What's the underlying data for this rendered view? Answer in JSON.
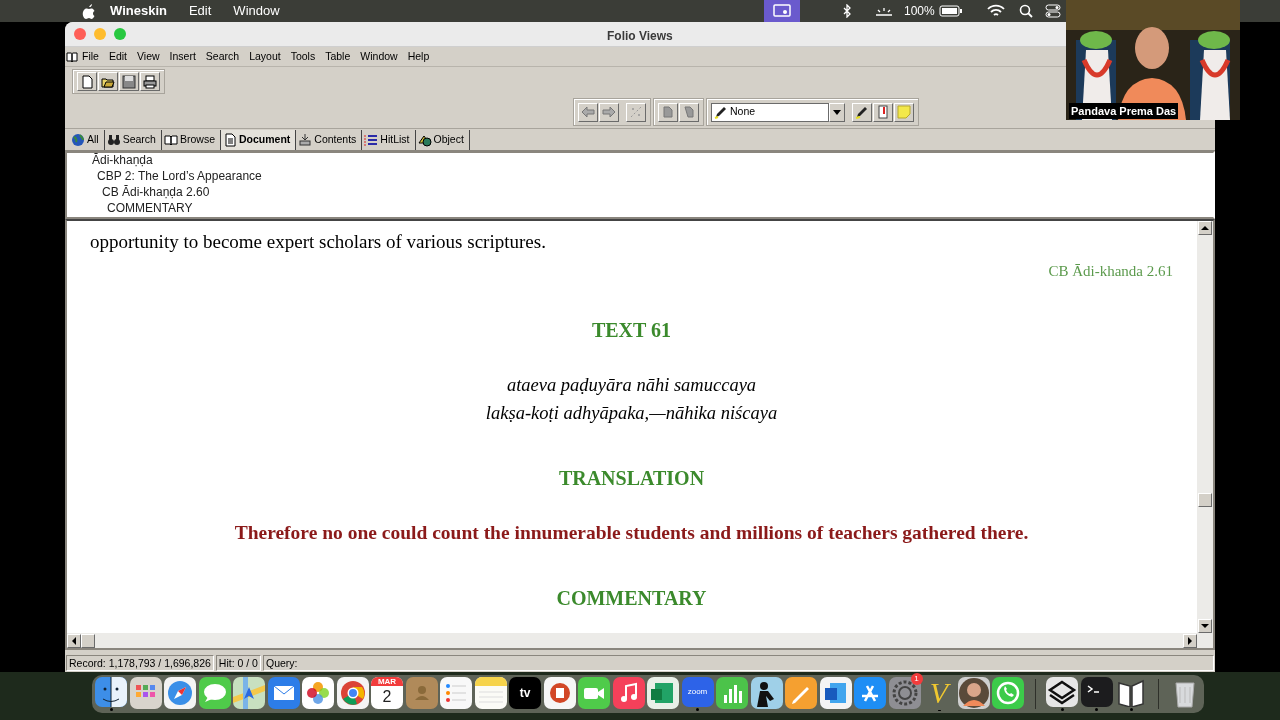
{
  "menu_bar": {
    "app": "Wineskin",
    "items": [
      "Edit",
      "Window"
    ],
    "battery": "100%"
  },
  "video": {
    "participant": "Pandava Prema Das"
  },
  "window": {
    "title": "Folio Views"
  },
  "menu": [
    "File",
    "Edit",
    "View",
    "Insert",
    "Search",
    "Layout",
    "Tools",
    "Table",
    "Window",
    "Help"
  ],
  "style_box": {
    "value": "None"
  },
  "tabs": [
    {
      "label": "All",
      "selected": false
    },
    {
      "label": "Search",
      "selected": false
    },
    {
      "label": "Browse",
      "selected": false
    },
    {
      "label": "Document",
      "selected": true
    },
    {
      "label": "Contents",
      "selected": false
    },
    {
      "label": "HitList",
      "selected": false
    },
    {
      "label": "Object",
      "selected": false
    }
  ],
  "outline": [
    {
      "text": "Ādi-khaṇḍa",
      "children": [
        {
          "text": "CBP 2: The Lord’s Appearance",
          "children": [
            {
              "text": "CB Ādi-khaṇḍa 2.60",
              "children": [
                {
                  "text": "COMMENTARY"
                }
              ]
            }
          ]
        }
      ]
    }
  ],
  "document": [
    {
      "kind": "body",
      "text": "opportunity to become expert scholars of various scriptures."
    },
    {
      "kind": "reference",
      "text": "CB Ādi-khanda 2.61"
    },
    {
      "kind": "heading",
      "text": "TEXT 61"
    },
    {
      "kind": "verse",
      "lines": [
        "ataeva paḍuyāra nāhi samuccaya",
        "lakṣa-koṭi adhyāpaka,—nāhika niścaya"
      ]
    },
    {
      "kind": "heading",
      "text": "TRANSLATION"
    },
    {
      "kind": "translation",
      "text": "Therefore no one could count the innumerable students and millions of teachers gathered there."
    },
    {
      "kind": "heading",
      "text": "COMMENTARY"
    }
  ],
  "status_bar": {
    "record": "Record: 1,178,793 / 1,696,826",
    "hit": "Hit: 0 / 0",
    "query": "Query:"
  },
  "dock": [
    {
      "kind": "finder",
      "running": true
    },
    {
      "kind": "launchpad"
    },
    {
      "kind": "compass"
    },
    {
      "kind": "messages"
    },
    {
      "kind": "maps"
    },
    {
      "kind": "mail"
    },
    {
      "kind": "photos"
    },
    {
      "kind": "browser"
    },
    {
      "kind": "calendar",
      "month": "MAR",
      "day": "2"
    },
    {
      "kind": "contacts"
    },
    {
      "kind": "reminders"
    },
    {
      "kind": "notes"
    },
    {
      "kind": "tv",
      "label": "tv"
    },
    {
      "kind": "slides"
    },
    {
      "kind": "video"
    },
    {
      "kind": "music"
    },
    {
      "kind": "sheet"
    },
    {
      "kind": "meeting",
      "label": "zoom",
      "running": true
    },
    {
      "kind": "chart"
    },
    {
      "kind": "reader"
    },
    {
      "kind": "pen"
    },
    {
      "kind": "word"
    },
    {
      "kind": "store"
    },
    {
      "kind": "settings",
      "badge": "1"
    },
    {
      "kind": "letter",
      "label": "V",
      "running": true
    },
    {
      "kind": "avatar"
    },
    {
      "kind": "phone"
    },
    {
      "kind": "separator"
    },
    {
      "kind": "layers",
      "running": true
    },
    {
      "kind": "terminal",
      "running": true
    },
    {
      "kind": "book",
      "running": true
    },
    {
      "kind": "separator"
    },
    {
      "kind": "trash"
    }
  ]
}
